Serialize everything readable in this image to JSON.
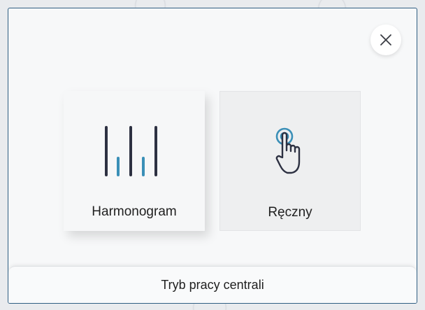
{
  "dialog": {
    "close_icon": "close-icon",
    "modes": [
      {
        "label": "Harmonogram",
        "icon": "schedule-bars-icon",
        "selected": true
      },
      {
        "label": "Ręczny",
        "icon": "hand-pointer-icon",
        "selected": false
      }
    ],
    "footer_title": "Tryb pracy centrali"
  },
  "colors": {
    "border": "#2f5e82",
    "icon_dark": "#2d3142",
    "icon_accent": "#3a8fb7"
  }
}
